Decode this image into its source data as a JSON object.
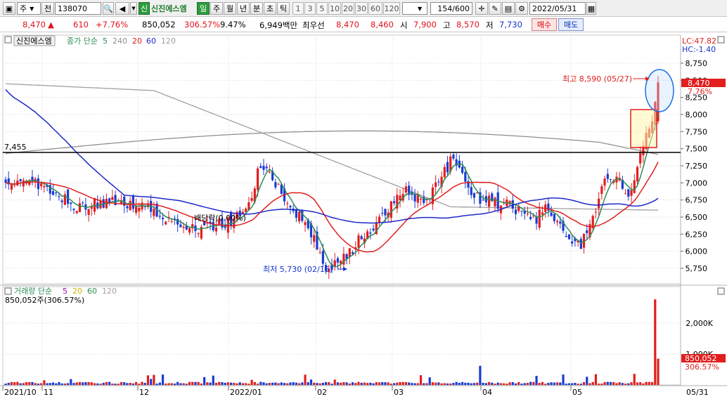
{
  "toolbar": {
    "period_label": "주",
    "prev_label": "전",
    "code": "138070",
    "name_tag": "신",
    "stock_name": "신진에스엠",
    "tabs": [
      "일",
      "주",
      "월",
      "년",
      "분",
      "초",
      "틱"
    ],
    "nums": [
      "1",
      "3",
      "5",
      "10",
      "20",
      "30",
      "60",
      "120"
    ],
    "count": "154/600",
    "date": "2022/05/31"
  },
  "price": {
    "current": "8,470",
    "arrow": "▲",
    "change": "610",
    "change_pct": "+7.76%",
    "volume": "850,052",
    "vol_ratio": "306.57%",
    "turnover": "9.47%",
    "amount": "6,949백만",
    "best_label": "최우선",
    "best_ask": "8,470",
    "best_bid": "8,460",
    "open_label": "시",
    "open": "7,900",
    "high_label": "고",
    "high": "8,570",
    "low_label": "저",
    "low": "7,730",
    "buy_label": "매수",
    "sell_label": "매도"
  },
  "chart": {
    "legend_name": "신진에스엠",
    "legend_ma_title": "종가 단순",
    "legend_ma": [
      "5",
      "240",
      "20",
      "60",
      "120"
    ],
    "lc": "LC:47.82",
    "hc": "HC:-1.40",
    "hline_label": "7,455",
    "high_annot": "최고 8,590 (05/27)",
    "low_annot": "최저 5,730 (02/15)",
    "mid_annot": "배당락(0.00%)",
    "last_price": "8,470",
    "last_pct": "7.76%",
    "price_ticks": [
      "8,750",
      "8,500",
      "8,250",
      "8,000",
      "7,750",
      "7,500",
      "7,250",
      "7,000",
      "6,750",
      "6,500",
      "6,250",
      "6,000",
      "5,750"
    ],
    "vol_legend_title": "거래량 단순",
    "vol_legend_ma": [
      "5",
      "20",
      "60",
      "120"
    ],
    "vol_info": "850,052주(306.57%)",
    "vol_ticks": [
      "2,000K",
      "1,000K"
    ],
    "vol_last": "850,052",
    "vol_last_pct": "306.57%",
    "x_labels": [
      "2021/10",
      "11",
      "12",
      "2022/01",
      "02",
      "03",
      "04",
      "05"
    ],
    "x_last": "05/31"
  },
  "colors": {
    "up": "#e21e1e",
    "down": "#1a3cd2",
    "ma5": "#2e8b57",
    "ma20": "#e21e1e",
    "ma60": "#1e28c8",
    "ma120": "#a0a0a0",
    "ma240": "#909090"
  },
  "chart_data": {
    "type": "candlestick",
    "ylim": [
      5600,
      8900
    ],
    "price_at_start": 7050,
    "price_at_end": 8470,
    "high": 8590,
    "low": 5730,
    "reference_line": 7455
  }
}
